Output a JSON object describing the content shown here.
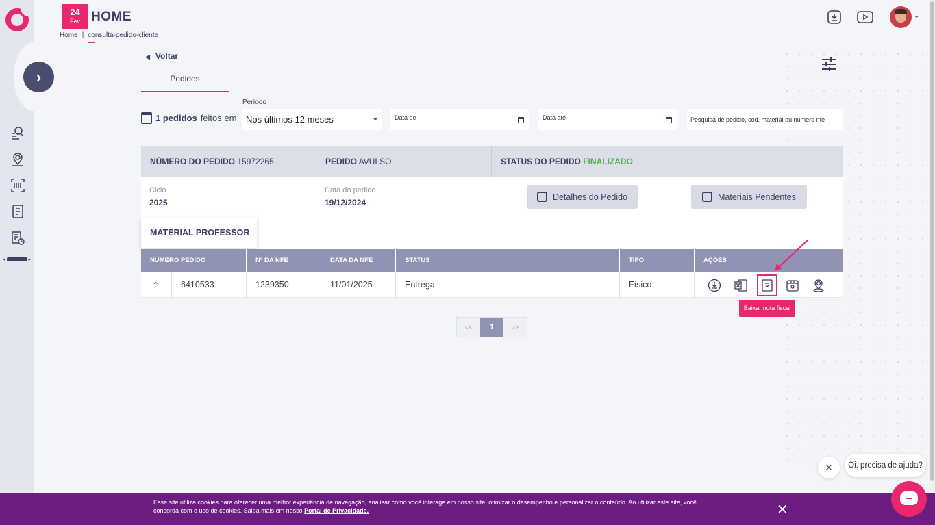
{
  "header": {
    "date_day": "24",
    "date_month": "Fev",
    "title": "HOME",
    "breadcrumb": [
      "Home",
      "consulta-pedido-cliente"
    ]
  },
  "nav": {
    "back_label": "Voltar"
  },
  "tabs": [
    {
      "label": "Pedidos",
      "active": true
    }
  ],
  "filters": {
    "count_bold": "1 pedidos",
    "count_rest": "feitos em",
    "period_label": "Período",
    "period_value": "Nos últimos 12 meses",
    "date_from_label": "Data de",
    "date_to_label": "Data até",
    "search_placeholder": "Pesquisa de pedido, cod. material ou número nfe"
  },
  "order": {
    "number_label": "NÚMERO DO PEDIDO",
    "number_value": "15972265",
    "type_label": "PEDIDO",
    "type_value": "AVULSO",
    "status_label": "STATUS DO PEDIDO",
    "status_value": "FINALIZADO",
    "status_color": "#4caf50",
    "cycle_label": "Ciclo",
    "cycle_value": "2025",
    "date_label": "Data do pedido",
    "date_value": "19/12/2024",
    "details_button": "Detalhes do Pedido",
    "pending_button": "Materiais Pendentes",
    "material_tag": "MATERIAL PROFESSOR"
  },
  "table": {
    "columns": [
      "NÚMERO PEDIDO",
      "Nº DA NFE",
      "DATA DA NFE",
      "STATUS",
      "TIPO",
      "AÇÕES"
    ],
    "rows": [
      {
        "pedido": "6410533",
        "nfe": "1239350",
        "data_nfe": "11/01/2025",
        "status": "Entrega",
        "tipo": "Físico"
      }
    ],
    "actions": [
      "download-icon",
      "excel-icon",
      "invoice-icon",
      "box-icon",
      "location-icon"
    ],
    "tooltip": "Baixar nota fiscal"
  },
  "pagination": {
    "prev": "<<",
    "current": "1",
    "next": ">>"
  },
  "chat": {
    "bubble": "Oi, precisa de ajuda?"
  },
  "cookie": {
    "text": "Esse site utiliza cookies para oferecer uma melhor experiência de navegação, analisar como você interage em nosso site, otimizar o desempenho e personalizar o conteúdo. Ao utilizar este site, você concorda com o uso de cookies. Saiba mais em nosso",
    "link": "Portal de Privacidade."
  },
  "colors": {
    "accent": "#e8276f",
    "navy": "#3d4060",
    "table_header": "#9094b2",
    "cookie_bg": "#6d1d82"
  }
}
